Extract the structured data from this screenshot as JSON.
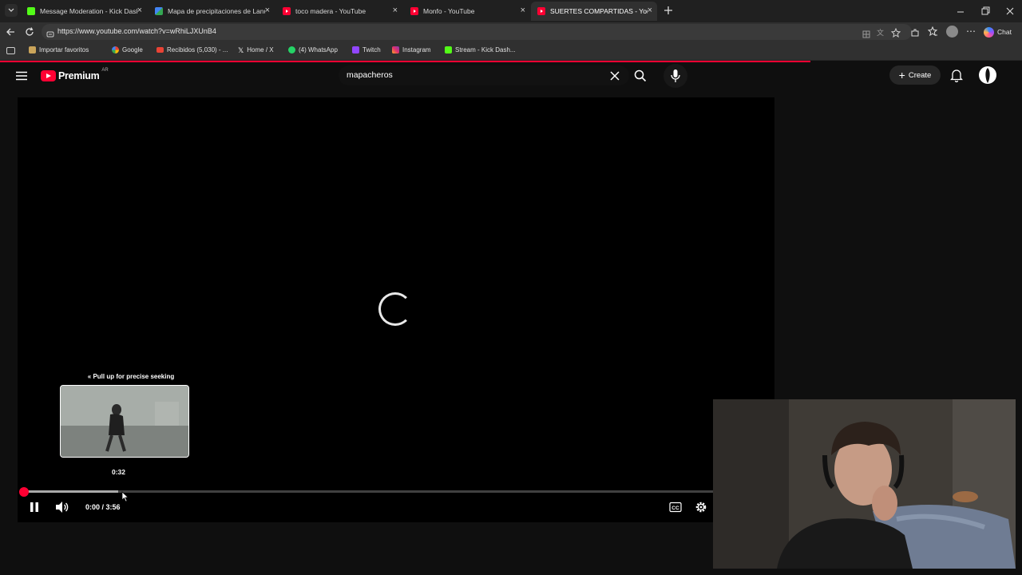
{
  "browser": {
    "tabs": [
      {
        "title": "Message Moderation - Kick Dashb",
        "favicon": "kick-icon",
        "active": false
      },
      {
        "title": "Mapa de precipitaciones de Lanús",
        "favicon": "maps-icon",
        "active": false
      },
      {
        "title": "toco madera - YouTube",
        "favicon": "youtube-icon",
        "active": false
      },
      {
        "title": "Monfo - YouTube",
        "favicon": "youtube-icon",
        "active": false
      },
      {
        "title": "SUERTES COMPARTIDAS - YouTube",
        "favicon": "youtube-icon",
        "active": true
      }
    ],
    "url": "https://www.youtube.com/watch?v=wRhiLJXUnB4",
    "copilot_label": "Chat",
    "bookmarks": [
      {
        "label": "Importar favoritos",
        "icon": "folder-icon"
      },
      {
        "label": "Google",
        "icon": "google-icon"
      },
      {
        "label": "Recibidos (5,030) - ...",
        "icon": "gmail-icon"
      },
      {
        "label": "Home / X",
        "icon": "x-icon"
      },
      {
        "label": "(4) WhatsApp",
        "icon": "whatsapp-icon"
      },
      {
        "label": "Twitch",
        "icon": "twitch-icon"
      },
      {
        "label": "Instagram",
        "icon": "instagram-icon"
      },
      {
        "label": "Stream - Kick Dash...",
        "icon": "kick-icon"
      }
    ]
  },
  "youtube": {
    "logo_text": "Premium",
    "country_code": "AR",
    "search_value": "mapacheros",
    "create_label": "Create"
  },
  "player": {
    "seek_hint": "Pull up for precise seeking",
    "preview_time": "0:32",
    "current_time": "0:00",
    "duration": "3:56",
    "time_display": "0:00 / 3:56",
    "progress_fraction": 0.0,
    "hover_fraction": 0.136
  },
  "colors": {
    "accent": "#ff0033",
    "background": "#0f0f0f",
    "chrome_bg": "#202020"
  }
}
